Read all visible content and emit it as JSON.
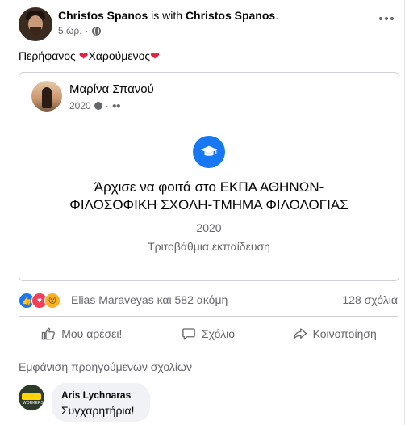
{
  "post": {
    "author": "Christos Spanos",
    "with_text": "is with",
    "tagged": "Christos Spanos",
    "period": ".",
    "time": "5 ώρ.",
    "dot": "·",
    "text_part1": "Περήφανος ",
    "text_part2": "Χαρούμενος"
  },
  "card": {
    "name": "Μαρίνα Σπανού",
    "year": "2020",
    "dot": "·",
    "title_line1": "Άρχισε να φοιτά στο ΕΚΠΑ ΑΘΗΝΩΝ-",
    "title_line2": "ΦΙΛΟΣΟΦΙΚΗ ΣΧΟΛΗ-ΤΜΗΜΑ ΦΙΛΟΛΟΓΙΑΣ",
    "event_year": "2020",
    "level": "Τριτοβάθμια εκπαίδευση"
  },
  "reactions": {
    "names": "Elias Maraveyas και 582 ακόμη",
    "comments": "128 σχόλια"
  },
  "actions": {
    "like": "Μου αρέσει!",
    "comment": "Σχόλιο",
    "share": "Κοινοποίηση"
  },
  "comments": {
    "previous": "Εμφάνιση προηγούμενων σχολίων",
    "items": [
      {
        "author": "Aris Lychnaras",
        "text": "Συγχαρητήρια!",
        "avatar_text": "WORKERS"
      }
    ]
  },
  "icons": {
    "globe": "globe-icon",
    "clock": "clock-icon",
    "friends": "friends-icon",
    "more": "more-options-icon",
    "education": "graduation-cap-icon",
    "like": "thumbs-up-icon",
    "comment": "comment-icon",
    "share": "share-icon"
  },
  "colors": {
    "brand_blue": "#1877f2",
    "secondary_text": "#65676b",
    "love_red": "#f33e58",
    "wow_yellow": "#f7b125"
  }
}
